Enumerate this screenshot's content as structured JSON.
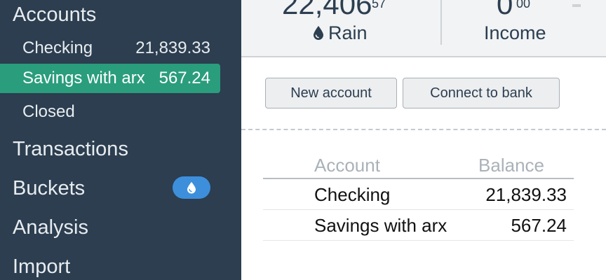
{
  "sidebar": {
    "accounts_label": "Accounts",
    "accounts": [
      {
        "label": "Checking",
        "amount": "21,839.33"
      },
      {
        "label": "Savings with arx",
        "amount": "567.24"
      }
    ],
    "closed_label": "Closed",
    "transactions_label": "Transactions",
    "buckets_label": "Buckets",
    "buckets_badge_icon": "droplet-icon",
    "analysis_label": "Analysis",
    "import_label": "Import"
  },
  "topbar": {
    "stats": [
      {
        "value": "22,406",
        "cents": "57",
        "label": "Rain",
        "icon": "droplet-icon"
      },
      {
        "value": "0",
        "cents": "00",
        "label": "Income"
      }
    ]
  },
  "toolbar": {
    "new_account_label": "New account",
    "connect_bank_label": "Connect to bank"
  },
  "table": {
    "headers": {
      "account": "Account",
      "balance": "Balance"
    },
    "rows": [
      {
        "account": "Checking",
        "balance": "21,839.33"
      },
      {
        "account": "Savings with arx",
        "balance": "567.24"
      }
    ]
  },
  "colors": {
    "sidebar_bg": "#2c3e50",
    "selected_bg": "#2a9d7c",
    "badge_bg": "#3d8fdc"
  }
}
